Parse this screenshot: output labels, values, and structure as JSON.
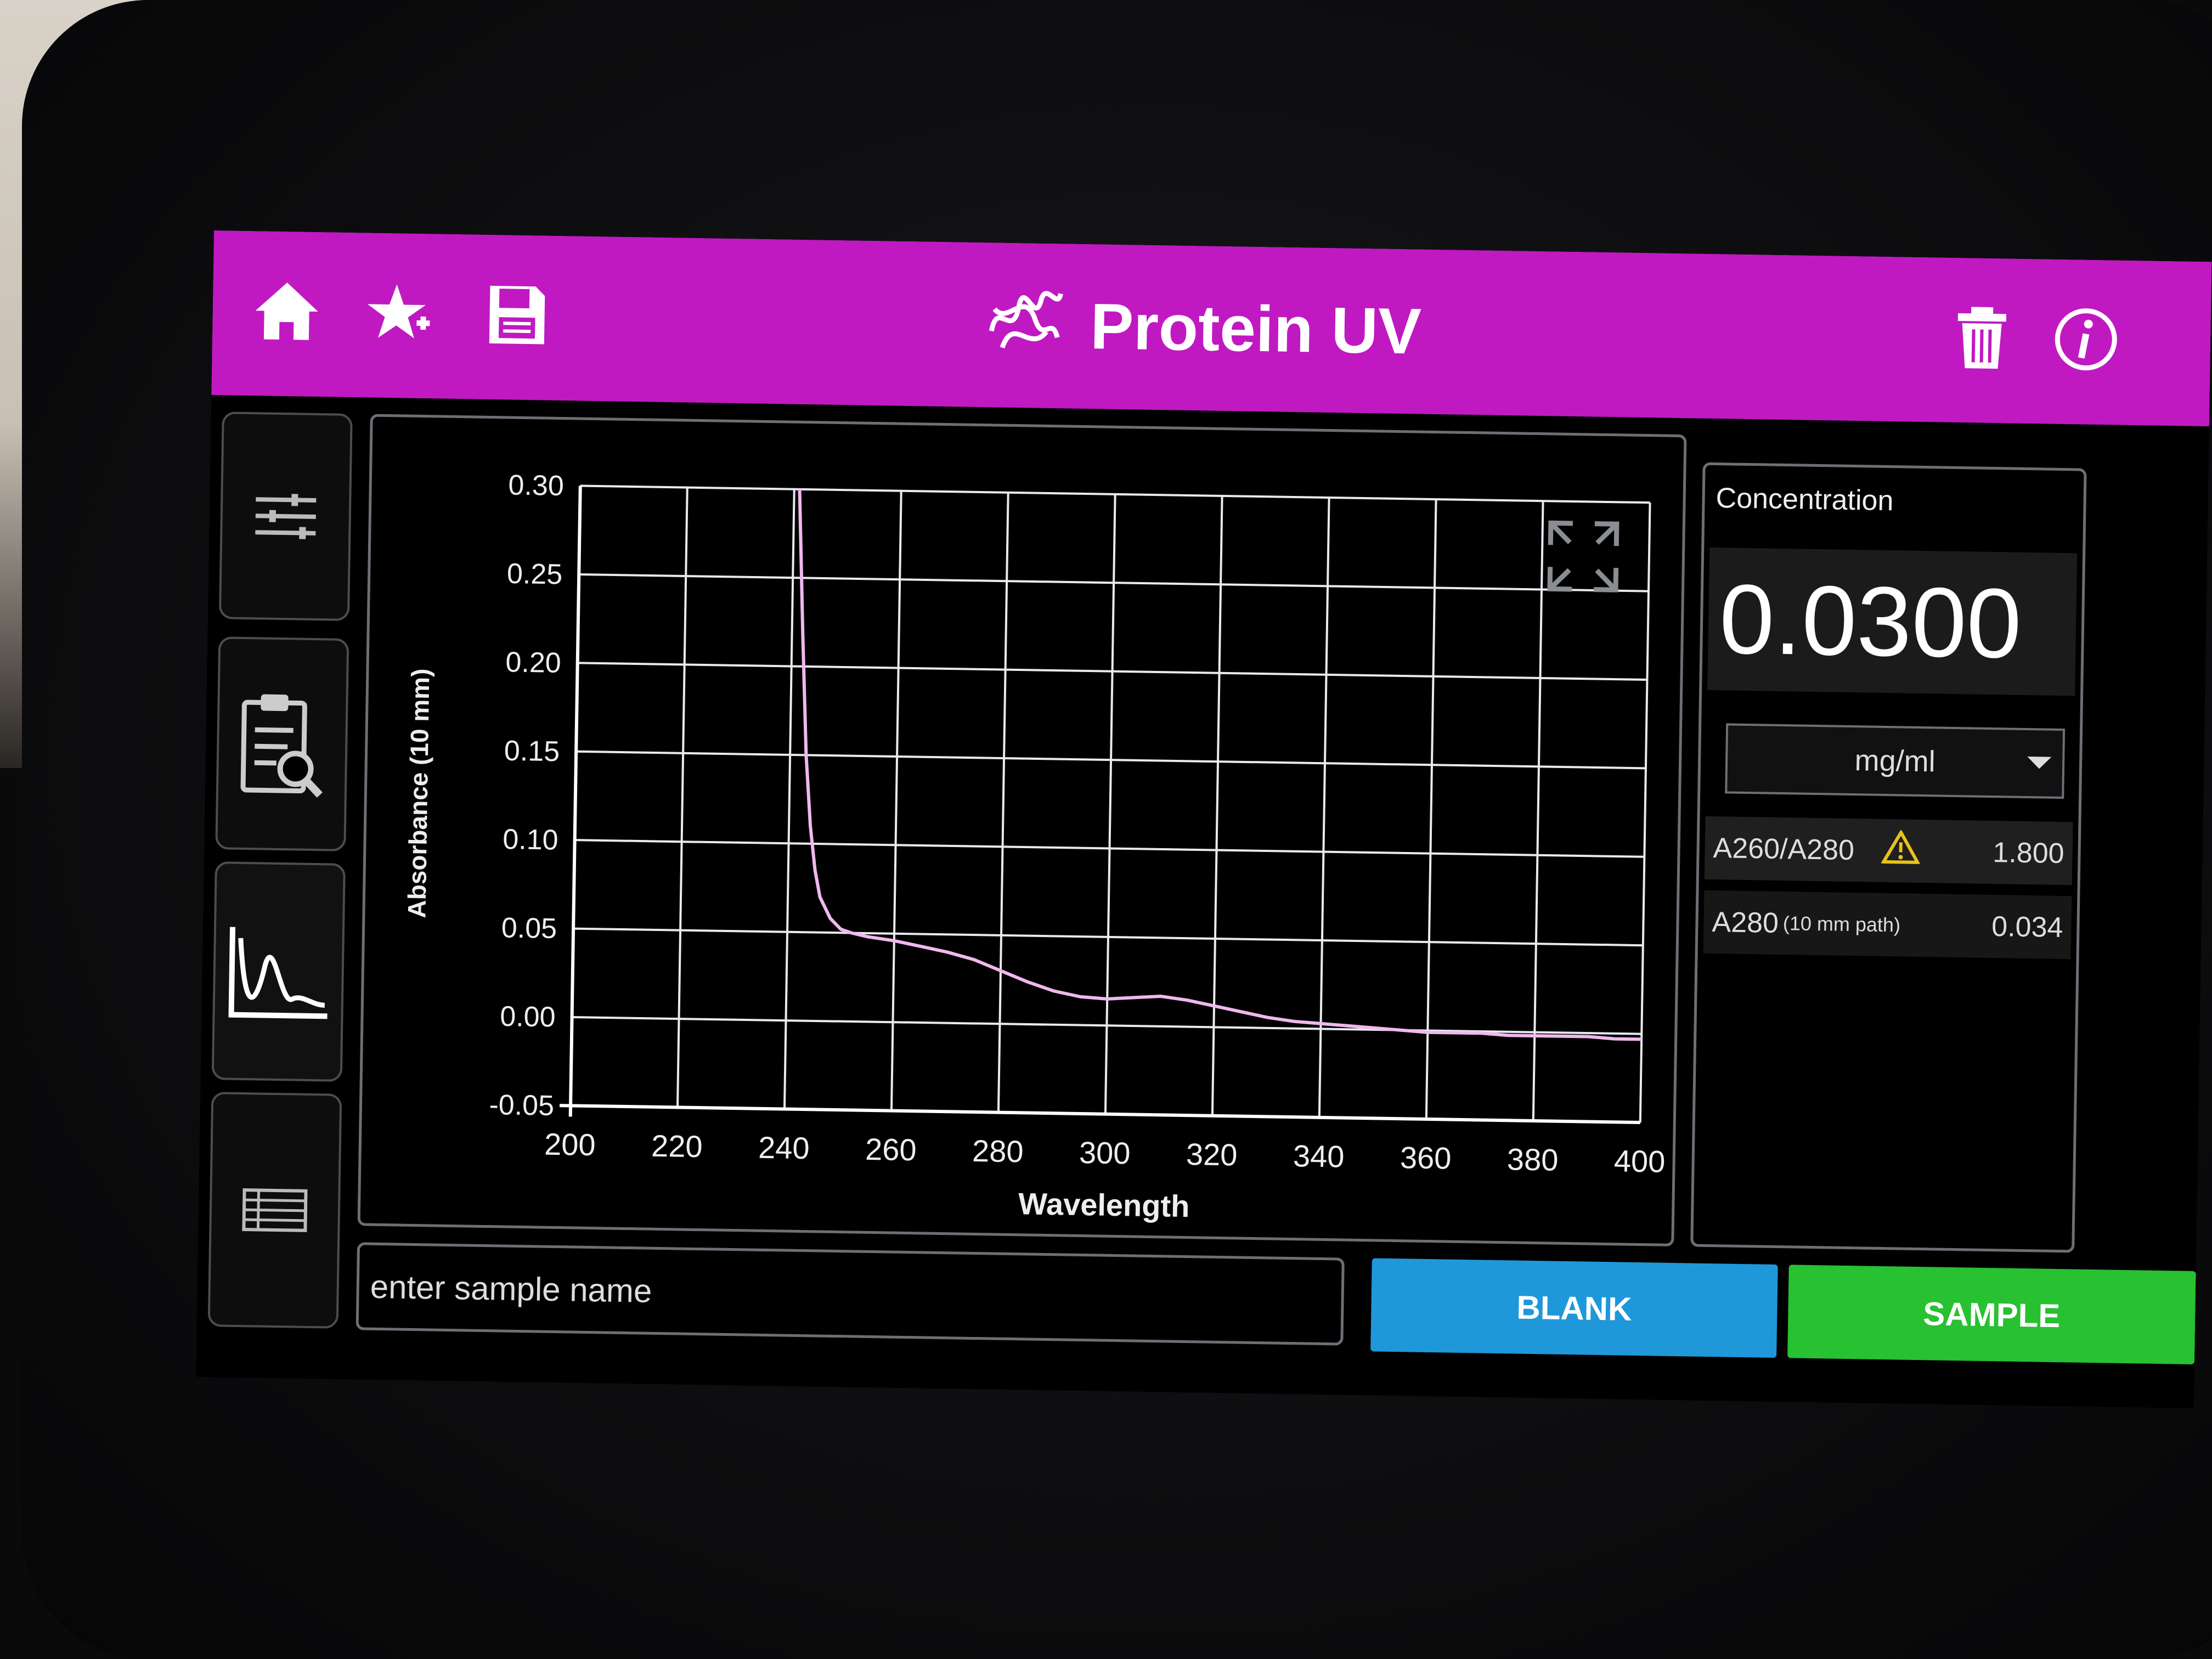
{
  "header": {
    "title": "Protein UV",
    "accent_color": "#c019c2",
    "left_icons": [
      "home-icon",
      "favorite-add-icon",
      "save-icon"
    ],
    "right_icons": [
      "trash-icon",
      "info-icon"
    ]
  },
  "rail": {
    "items": [
      "sliders-icon",
      "clipboard-search-icon",
      "spectrum-graph-icon",
      "table-list-icon"
    ]
  },
  "chart_data": {
    "type": "line",
    "xlabel": "Wavelength",
    "ylabel": "Absorbance (10 mm)",
    "xlim": [
      200,
      400
    ],
    "ylim": [
      -0.05,
      0.3
    ],
    "xticks": [
      "200",
      "220",
      "240",
      "260",
      "280",
      "300",
      "320",
      "340",
      "360",
      "380",
      "400"
    ],
    "yticks": [
      "0.30",
      "0.25",
      "0.20",
      "0.15",
      "0.10",
      "0.05",
      "0.00",
      "-0.05"
    ],
    "grid": true,
    "line_color": "#f0b8ee",
    "series": [
      {
        "x": [
          241,
          242,
          243,
          244,
          245,
          246,
          248,
          250,
          252,
          255,
          260,
          265,
          270,
          275,
          280,
          285,
          290,
          295,
          300,
          305,
          310,
          315,
          320,
          325,
          330,
          335,
          340,
          345,
          350,
          355,
          360,
          365,
          370,
          375,
          380,
          385,
          390,
          395,
          400
        ],
        "values": [
          0.3,
          0.22,
          0.15,
          0.11,
          0.085,
          0.07,
          0.058,
          0.052,
          0.05,
          0.048,
          0.046,
          0.043,
          0.04,
          0.036,
          0.03,
          0.024,
          0.019,
          0.016,
          0.015,
          0.016,
          0.017,
          0.015,
          0.012,
          0.009,
          0.006,
          0.004,
          0.003,
          0.002,
          0.001,
          0.0,
          -0.001,
          -0.001,
          -0.001,
          -0.002,
          -0.002,
          -0.002,
          -0.002,
          -0.003,
          -0.003
        ]
      }
    ]
  },
  "results": {
    "concentration_label": "Concentration",
    "concentration_value": "0.0300",
    "unit": "mg/ml",
    "ratio_label": "A260/A280",
    "ratio_value": "1.800",
    "a280_label": "A280",
    "a280_path": "(10 mm path)",
    "a280_value": "0.034"
  },
  "controls": {
    "sample_placeholder": "enter sample name",
    "blank_label": "BLANK",
    "sample_label": "SAMPLE"
  }
}
